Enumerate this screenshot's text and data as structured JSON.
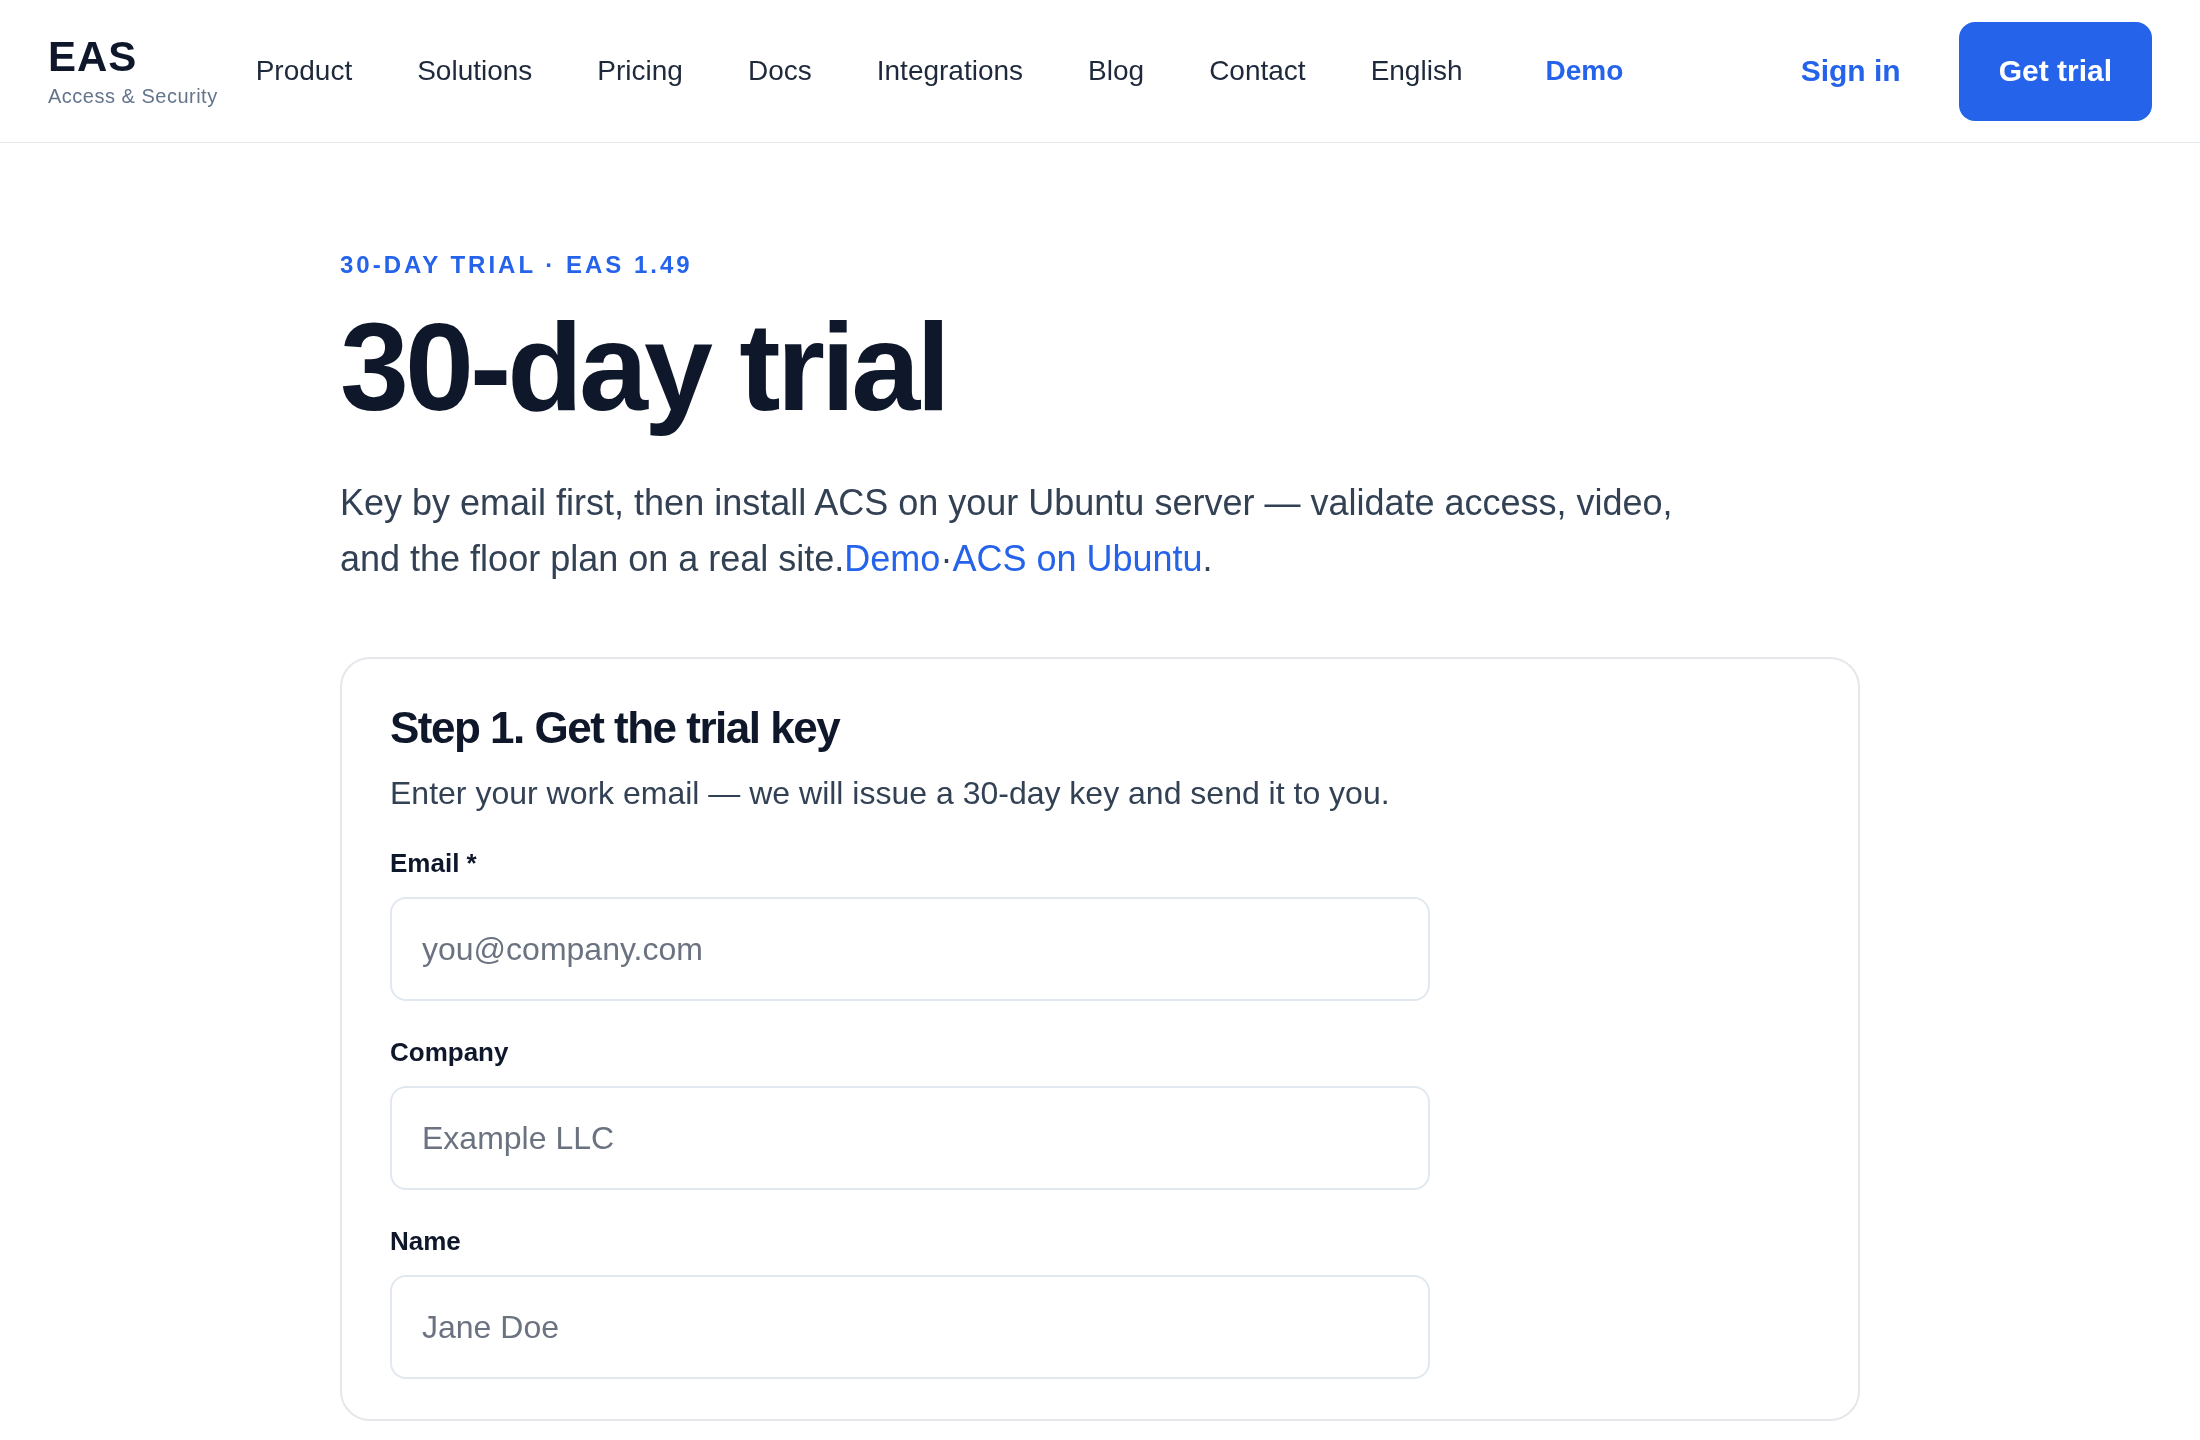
{
  "header": {
    "logo": {
      "title": "EAS",
      "subtitle": "Access & Security"
    },
    "nav": [
      {
        "label": "Product",
        "kind": "link"
      },
      {
        "label": "Solutions",
        "kind": "link"
      },
      {
        "label": "Pricing",
        "kind": "link"
      },
      {
        "label": "Docs",
        "kind": "link"
      },
      {
        "label": "Integrations",
        "kind": "link"
      },
      {
        "label": "Blog",
        "kind": "link"
      },
      {
        "label": "Contact",
        "kind": "link"
      },
      {
        "label": "English",
        "kind": "link"
      },
      {
        "label": "Demo",
        "kind": "accent"
      }
    ],
    "sign_in": "Sign in",
    "cta": "Get trial"
  },
  "hero": {
    "eyebrow": "30-DAY TRIAL · EAS 1.49",
    "title": "30-day trial",
    "intro": {
      "text": "Key by email first, then install ACS on your Ubuntu server — validate access, video, and the floor plan on a real site.",
      "links": [
        "Demo",
        "ACS on Ubuntu"
      ],
      "separator": "·",
      "end": "."
    }
  },
  "card": {
    "title": "Step 1. Get the trial key",
    "subtitle": "Enter your work email — we will issue a 30-day key and send it to you.",
    "fields": [
      {
        "label": "Email *",
        "placeholder": "you@company.com"
      },
      {
        "label": "Company",
        "placeholder": "Example LLC"
      },
      {
        "label": "Name",
        "placeholder": "Jane Doe"
      }
    ]
  }
}
